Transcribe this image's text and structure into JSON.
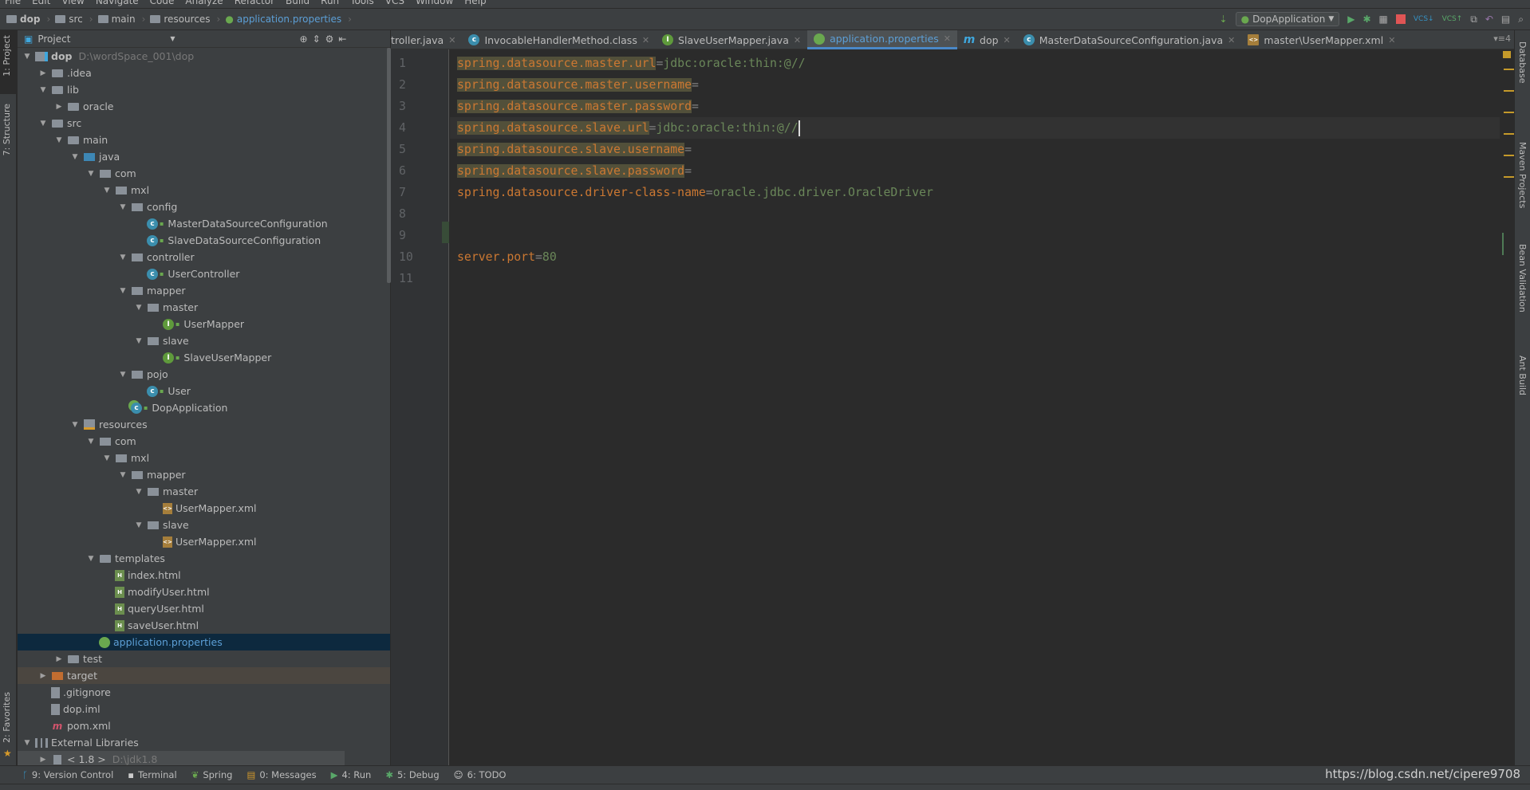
{
  "menu": [
    "File",
    "Edit",
    "View",
    "Navigate",
    "Code",
    "Analyze",
    "Refactor",
    "Build",
    "Run",
    "Tools",
    "VCS",
    "Window",
    "Help"
  ],
  "breadcrumbs": [
    "dop",
    "src",
    "main",
    "resources",
    "application.properties"
  ],
  "run_config": "DopApplication",
  "left_tool_tabs": {
    "project": "1: Project",
    "structure": "7: Structure",
    "favorites": "2: Favorites"
  },
  "project_panel": {
    "title": "Project",
    "tree": [
      {
        "d": 0,
        "a": "open",
        "i": "module",
        "t": "dop",
        "extra": "D:\\wordSpace_001\\dop",
        "bold": true
      },
      {
        "d": 1,
        "a": "closed",
        "i": "folder",
        "t": ".idea"
      },
      {
        "d": 1,
        "a": "open",
        "i": "folder",
        "t": "lib"
      },
      {
        "d": 2,
        "a": "closed",
        "i": "folder",
        "t": "oracle"
      },
      {
        "d": 1,
        "a": "open",
        "i": "folder",
        "t": "src"
      },
      {
        "d": 2,
        "a": "open",
        "i": "folder",
        "t": "main"
      },
      {
        "d": 3,
        "a": "open",
        "i": "src",
        "t": "java"
      },
      {
        "d": 4,
        "a": "open",
        "i": "package",
        "t": "com"
      },
      {
        "d": 5,
        "a": "open",
        "i": "package",
        "t": "mxl"
      },
      {
        "d": 6,
        "a": "open",
        "i": "package",
        "t": "config"
      },
      {
        "d": 7,
        "i": "class",
        "t": "MasterDataSourceConfiguration",
        "lock": true
      },
      {
        "d": 7,
        "i": "class",
        "t": "SlaveDataSourceConfiguration",
        "lock": true
      },
      {
        "d": 6,
        "a": "open",
        "i": "package",
        "t": "controller"
      },
      {
        "d": 7,
        "i": "class",
        "t": "UserController",
        "lock": true
      },
      {
        "d": 6,
        "a": "open",
        "i": "package",
        "t": "mapper"
      },
      {
        "d": 7,
        "a": "open",
        "i": "package",
        "t": "master"
      },
      {
        "d": 8,
        "i": "iface",
        "t": "UserMapper",
        "lock": true
      },
      {
        "d": 7,
        "a": "open",
        "i": "package",
        "t": "slave"
      },
      {
        "d": 8,
        "i": "iface",
        "t": "SlaveUserMapper",
        "lock": true
      },
      {
        "d": 6,
        "a": "open",
        "i": "package",
        "t": "pojo"
      },
      {
        "d": 7,
        "i": "class",
        "t": "User",
        "lock": true
      },
      {
        "d": 6,
        "i": "spring",
        "t": "DopApplication",
        "lock": true
      },
      {
        "d": 3,
        "a": "open",
        "i": "res",
        "t": "resources"
      },
      {
        "d": 4,
        "a": "open",
        "i": "package",
        "t": "com"
      },
      {
        "d": 5,
        "a": "open",
        "i": "package",
        "t": "mxl"
      },
      {
        "d": 6,
        "a": "open",
        "i": "package",
        "t": "mapper"
      },
      {
        "d": 7,
        "a": "open",
        "i": "package",
        "t": "master"
      },
      {
        "d": 8,
        "i": "xml",
        "t": "UserMapper.xml"
      },
      {
        "d": 7,
        "a": "open",
        "i": "package",
        "t": "slave"
      },
      {
        "d": 8,
        "i": "xml",
        "t": "UserMapper.xml"
      },
      {
        "d": 4,
        "a": "open",
        "i": "folder",
        "t": "templates"
      },
      {
        "d": 5,
        "i": "html",
        "t": "index.html"
      },
      {
        "d": 5,
        "i": "html",
        "t": "modifyUser.html"
      },
      {
        "d": 5,
        "i": "html",
        "t": "queryUser.html"
      },
      {
        "d": 5,
        "i": "html",
        "t": "saveUser.html"
      },
      {
        "d": 4,
        "i": "props",
        "t": "application.properties",
        "state": "selected"
      },
      {
        "d": 2,
        "a": "closed",
        "i": "folder",
        "t": "test"
      },
      {
        "d": 1,
        "a": "closed",
        "i": "target",
        "t": "target",
        "state": "highlight"
      },
      {
        "d": 1,
        "i": "file",
        "t": ".gitignore"
      },
      {
        "d": 1,
        "i": "file",
        "t": "dop.iml"
      },
      {
        "d": 1,
        "i": "maven",
        "t": "pom.xml"
      },
      {
        "d": 0,
        "a": "open",
        "i": "libs",
        "t": "External Libraries"
      },
      {
        "d": 1,
        "a": "closed",
        "i": "jdk",
        "t": "< 1.8 >",
        "extra": "D:\\jdk1.8",
        "state": "lib"
      }
    ]
  },
  "tabs": [
    {
      "label": "troller.java",
      "icon": "",
      "color": ""
    },
    {
      "label": "InvocableHandlerMethod.class",
      "icon": "c",
      "color": "#3b8ead"
    },
    {
      "label": "SlaveUserMapper.java",
      "icon": "I",
      "color": "#5f9a3c"
    },
    {
      "label": "application.properties",
      "icon": "p",
      "color": "#6aa84f",
      "active": true
    },
    {
      "label": "dop",
      "icon": "m",
      "color": ""
    },
    {
      "label": "MasterDataSourceConfiguration.java",
      "icon": "c",
      "color": "#3b8ead"
    },
    {
      "label": "master\\UserMapper.xml",
      "icon": "x",
      "color": "#a57e3b"
    }
  ],
  "tab_overflow": "4",
  "code": [
    {
      "n": "1",
      "k": "spring.datasource.master.url",
      "v": "jdbc:oracle:thin:@//",
      "hl": true
    },
    {
      "n": "2",
      "k": "spring.datasource.master.username",
      "v": "",
      "hl": true
    },
    {
      "n": "3",
      "k": "spring.datasource.master.password",
      "v": "",
      "hl": true
    },
    {
      "n": "4",
      "k": "spring.datasource.slave.url",
      "v": "jdbc:oracle:thin:@//",
      "hl": true,
      "current": true
    },
    {
      "n": "5",
      "k": "spring.datasource.slave.username",
      "v": "",
      "hl": true
    },
    {
      "n": "6",
      "k": "spring.datasource.slave.password",
      "v": "",
      "hl": true
    },
    {
      "n": "7",
      "k": "spring.datasource.driver-class-name",
      "v": "oracle.jdbc.driver.OracleDriver"
    },
    {
      "n": "8",
      "k": ""
    },
    {
      "n": "9",
      "k": ""
    },
    {
      "n": "10",
      "k": "server.port",
      "v": "80"
    },
    {
      "n": "11",
      "k": ""
    }
  ],
  "right_tool_tabs": [
    "Database",
    "Maven Projects",
    "Bean Validation",
    "Ant Build"
  ],
  "bottom_tools": [
    {
      "label": "9: Version Control",
      "icon": "vcs-icon"
    },
    {
      "label": "Terminal",
      "icon": "terminal-icon"
    },
    {
      "label": "Spring",
      "icon": "spring-icon"
    },
    {
      "label": "0: Messages",
      "icon": "messages-icon"
    },
    {
      "label": "4: Run",
      "icon": "run-icon"
    },
    {
      "label": "5: Debug",
      "icon": "debug-icon"
    },
    {
      "label": "6: TODO",
      "icon": "todo-icon"
    }
  ],
  "watermark": "https://blog.csdn.net/cipere9708",
  "colors": {
    "accent": "#4a88c7",
    "key": "#cc7832",
    "value": "#6a8759",
    "selection": "#0d293e"
  }
}
